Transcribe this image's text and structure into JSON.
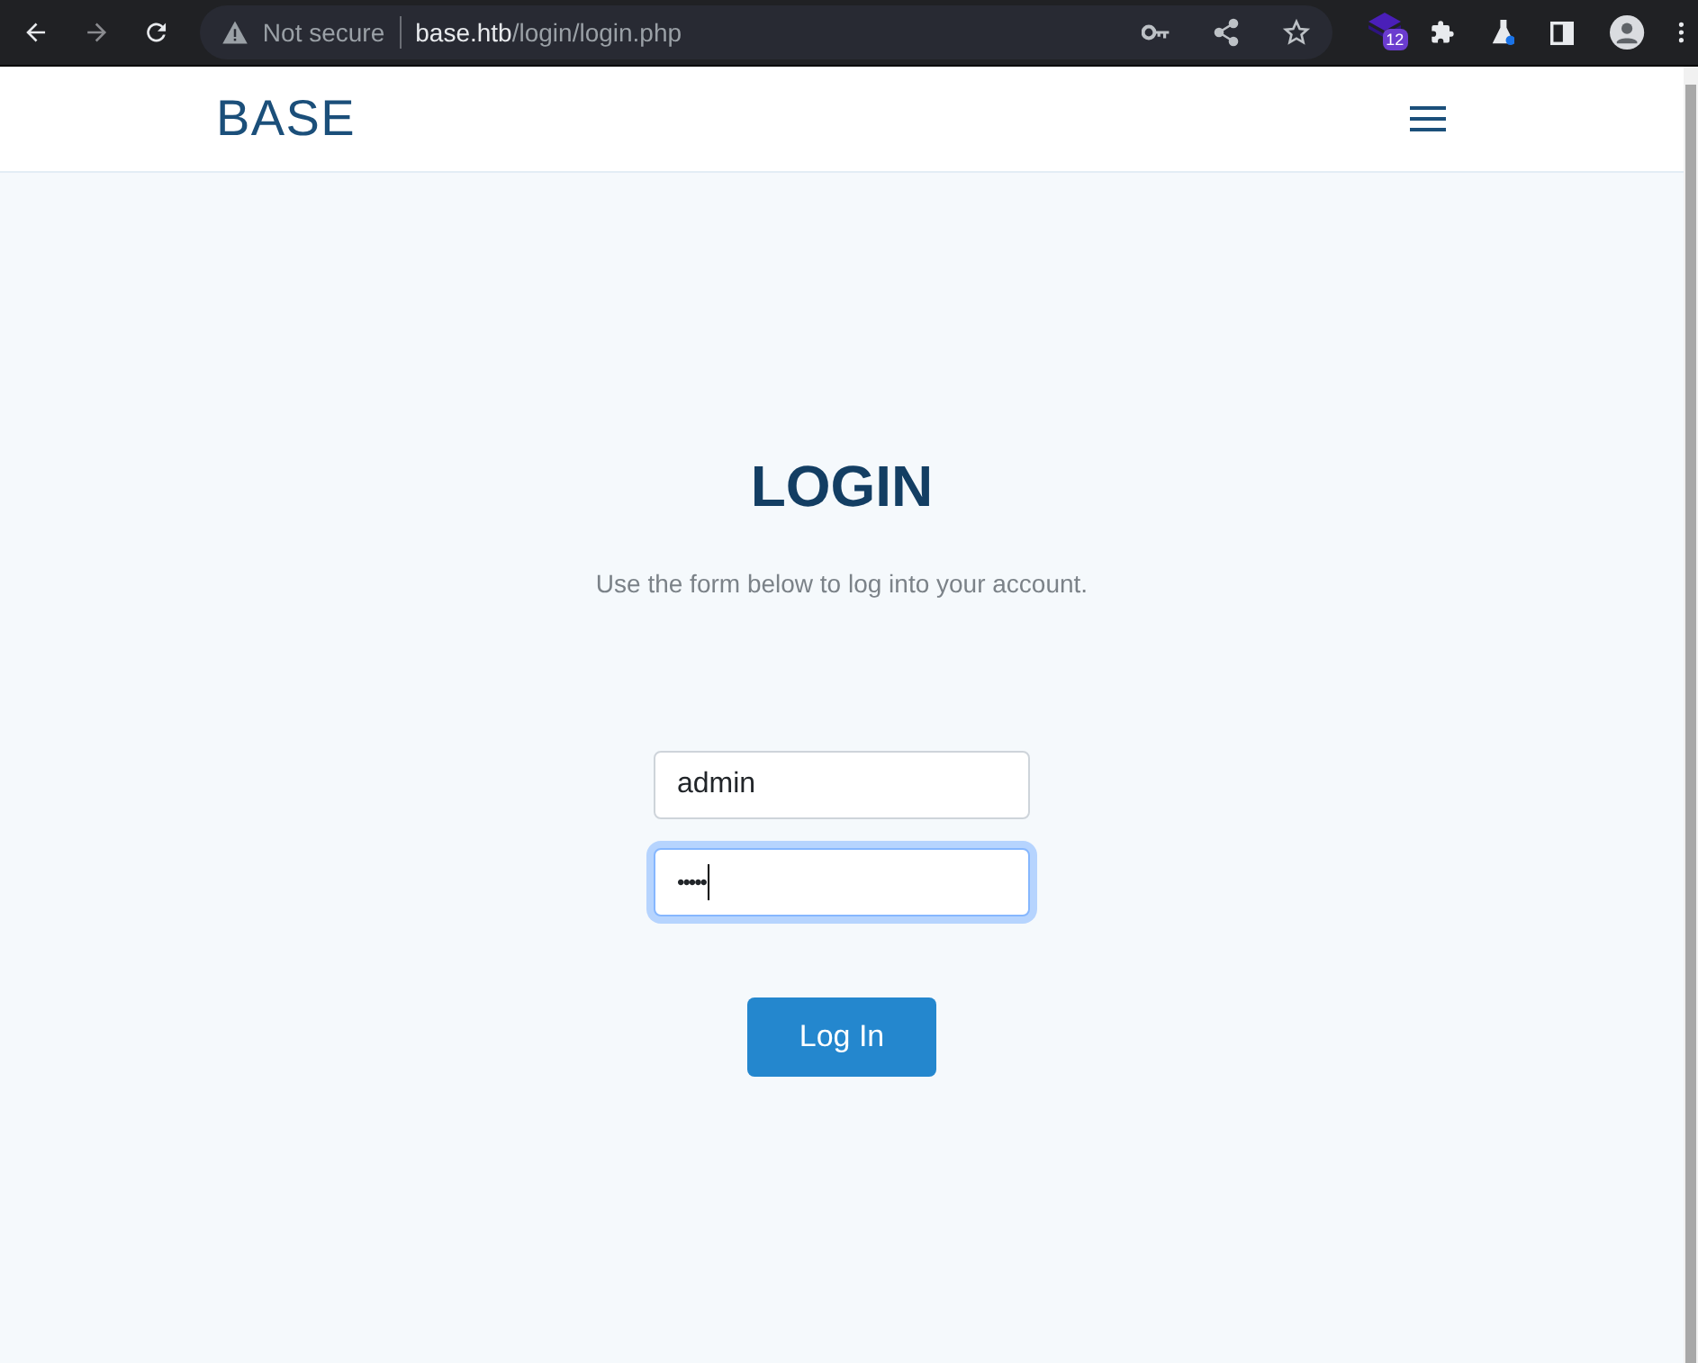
{
  "browser": {
    "security_label": "Not secure",
    "url_host": "base.htb",
    "url_path": "/login/login.php",
    "extension_badge": "12"
  },
  "navbar": {
    "brand": "BASE"
  },
  "login": {
    "title": "LOGIN",
    "subtitle": "Use the form below to log into your account.",
    "fields": [
      {
        "kind": "text",
        "value": "admin",
        "focused": false
      },
      {
        "kind": "password",
        "value": "•••••",
        "focused": true
      }
    ],
    "button": "Log In"
  }
}
